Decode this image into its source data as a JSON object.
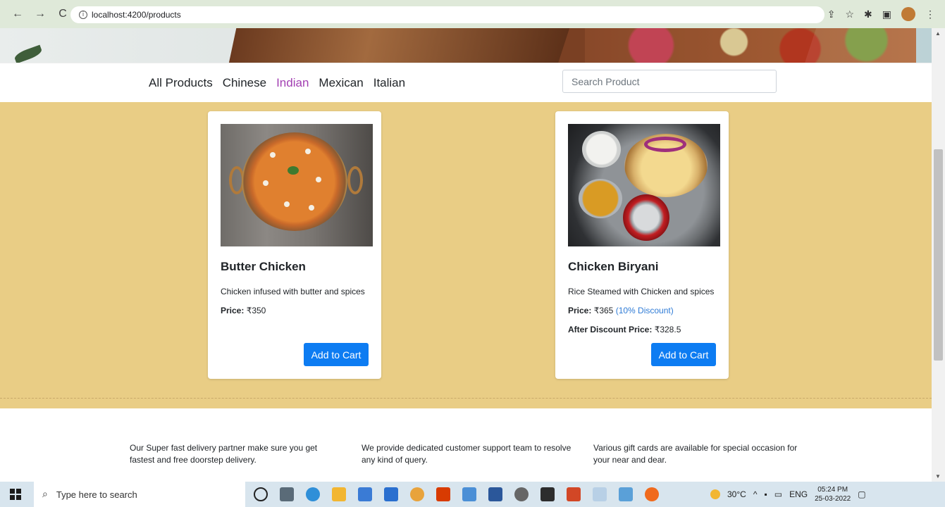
{
  "browser": {
    "back_icon": "arrow-left-icon",
    "forward_icon": "arrow-right-icon",
    "reload_icon": "reload-icon",
    "url": "localhost:4200/products"
  },
  "nav": {
    "categories": [
      "All Products",
      "Chinese",
      "Indian",
      "Mexican",
      "Italian"
    ],
    "active_category": "Indian",
    "search_placeholder": "Search Product"
  },
  "products": [
    {
      "title": "Butter Chicken",
      "description": "Chicken infused with butter and spices",
      "price_label": "Price:",
      "price": "₹350",
      "button": "Add to Cart"
    },
    {
      "title": "Chicken Biryani",
      "description": "Rice Steamed with Chicken and spices",
      "price_label": "Price:",
      "price": "₹365",
      "discount": "(10% Discount)",
      "after_label": "After Discount Price:",
      "after_price": "₹328.5",
      "button": "Add to Cart"
    }
  ],
  "footer": {
    "features": [
      "Our Super fast delivery partner make sure you get fastest and free doorstep delivery.",
      "We provide dedicated customer support team to resolve any kind of query.",
      "Various gift cards are available for special occasion for your near and dear."
    ]
  },
  "taskbar": {
    "search_placeholder": "Type here to search",
    "temperature": "30°C",
    "language": "ENG",
    "time": "05:24 PM",
    "date": "25-03-2022"
  },
  "colors": {
    "products_bg": "#e9cd85",
    "active_category": "#a23fb2",
    "button": "#0d7cf2",
    "discount": "#2e7bd6"
  }
}
